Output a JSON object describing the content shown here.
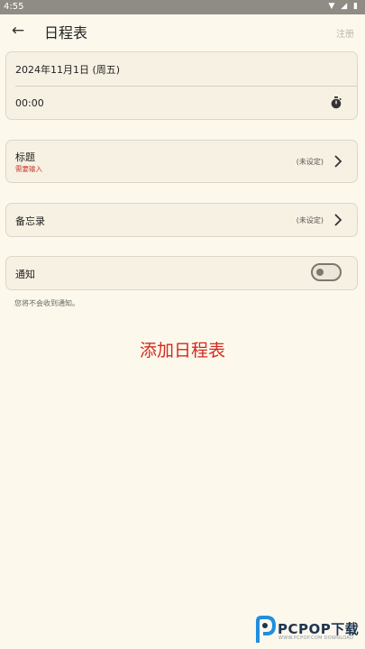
{
  "status_bar": {
    "time": "4:55"
  },
  "app_bar": {
    "title": "日程表",
    "register": "注册"
  },
  "datetime": {
    "date": "2024年11月1日 (周五)",
    "time": "00:00"
  },
  "title_row": {
    "label": "标题",
    "required": "需要输入",
    "value": "(未设定)"
  },
  "memo_row": {
    "label": "备忘录",
    "value": "(未设定)"
  },
  "notify_row": {
    "label": "通知",
    "enabled": false,
    "hint": "您将不会收到通知。"
  },
  "caption": "添加日程表",
  "watermark": {
    "brand": "PCPOP下载",
    "subtitle": "WWW.PCPOP.COM DOWNLOAD"
  },
  "colors": {
    "background": "#fdf8ec",
    "card": "#f7f1e3",
    "accent_red": "#d12b1f",
    "required_red": "#c63a2a"
  }
}
